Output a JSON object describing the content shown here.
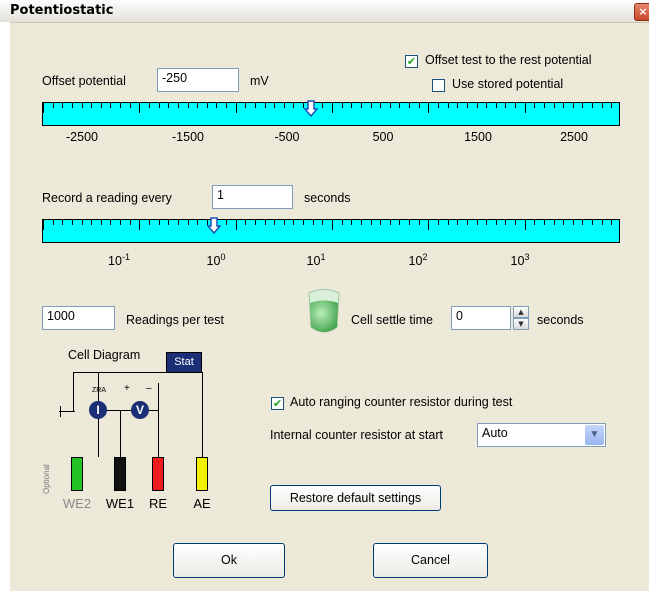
{
  "window": {
    "title": "Potentiostatic",
    "close_symbol": "×"
  },
  "offset": {
    "label": "Offset potential",
    "value": "-250",
    "unit": "mV",
    "offset_rest_label": "Offset test to the rest potential",
    "offset_rest_checked": true,
    "use_stored_label": "Use stored potential",
    "use_stored_checked": false,
    "scale_ticks": [
      "-2500",
      "-1500",
      "-500",
      "500",
      "1500",
      "2500"
    ],
    "slider_value_mv": -250
  },
  "interval": {
    "label": "Record a reading every",
    "value": "1",
    "unit": "seconds",
    "scale_ticks": [
      {
        "base": "10",
        "exp": "-1"
      },
      {
        "base": "10",
        "exp": "0"
      },
      {
        "base": "10",
        "exp": "1"
      },
      {
        "base": "10",
        "exp": "2"
      },
      {
        "base": "10",
        "exp": "3"
      }
    ],
    "slider_value_s": 1
  },
  "readings": {
    "value": "1000",
    "label": "Readings per test"
  },
  "settle": {
    "label": "Cell settle time",
    "value": "0",
    "unit": "seconds"
  },
  "cell_diagram": {
    "title": "Cell Diagram",
    "stat_label": "Stat",
    "zra_label": "ZRA",
    "plus_label": "+",
    "minus_label": "–",
    "meter_i": "I",
    "meter_v": "V",
    "optional_label": "Optional",
    "electrodes": [
      {
        "label": "WE2",
        "color": "#22c322"
      },
      {
        "label": "WE1",
        "color": "#111111"
      },
      {
        "label": "RE",
        "color": "#ee1c1c"
      },
      {
        "label": "AE",
        "color": "#f2f200"
      }
    ]
  },
  "auto_range": {
    "label": "Auto ranging counter resistor during test",
    "checked": true
  },
  "counter_resistor": {
    "label": "Internal counter resistor at start",
    "value": "Auto"
  },
  "buttons": {
    "restore": "Restore default settings",
    "ok": "Ok",
    "cancel": "Cancel"
  },
  "colors": {
    "scale": "#00ffff",
    "pointer": "#1d4fb8",
    "dialog": "#ece9d8"
  }
}
